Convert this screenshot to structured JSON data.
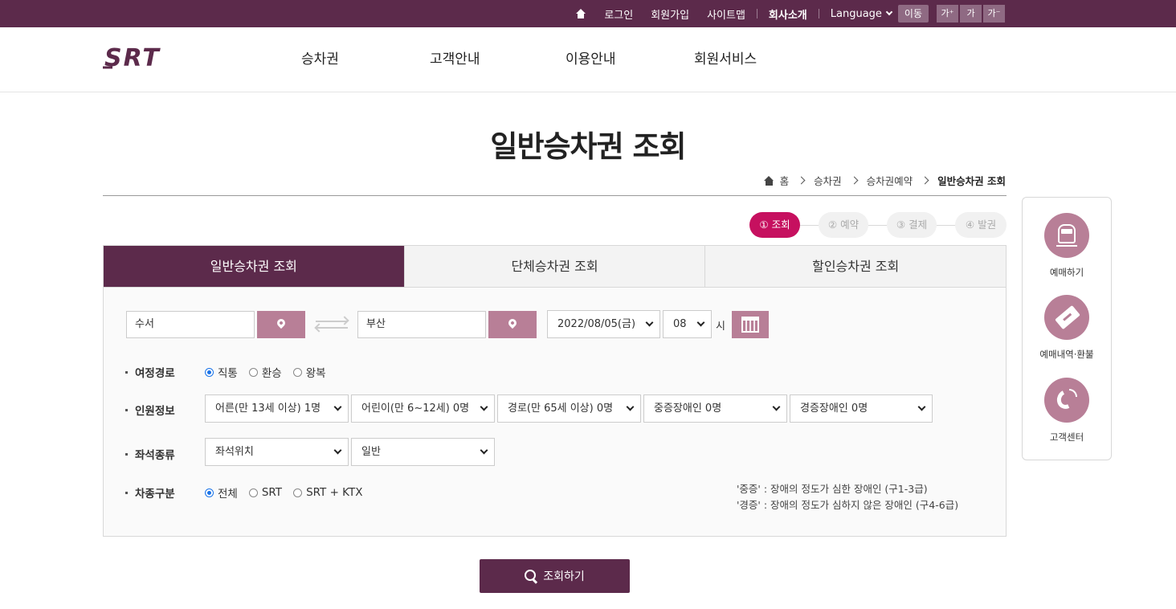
{
  "topbar": {
    "login": "로그인",
    "signup": "회원가입",
    "sitemap": "사이트맵",
    "company": "회사소개",
    "language": "Language",
    "go": "이동",
    "font_up": "가⁺",
    "font_normal": "가",
    "font_down": "가⁻"
  },
  "header": {
    "logo": "SRT",
    "nav": [
      "승차권",
      "고객안내",
      "이용안내",
      "회원서비스"
    ]
  },
  "page": {
    "title": "일반승차권 조회",
    "breadcrumb": [
      "홈",
      "승차권",
      "승차권예약",
      "일반승차권 조회"
    ]
  },
  "steps": [
    "① 조회",
    "② 예약",
    "③ 결제",
    "④ 발권"
  ],
  "tabs": [
    "일반승차권 조회",
    "단체승차권 조회",
    "할인승차권 조회"
  ],
  "form": {
    "departure": "수서",
    "arrival": "부산",
    "date": "2022/08/05(금)",
    "hour": "08",
    "hour_unit": "시",
    "route_label": "여정경로",
    "route_options": [
      "직통",
      "환승",
      "왕복"
    ],
    "passenger_label": "인원정보",
    "passengers": [
      "어른(만 13세 이상) 1명",
      "어린이(만 6~12세) 0명",
      "경로(만 65세 이상) 0명",
      "중증장애인 0명",
      "경증장애인 0명"
    ],
    "seat_label": "좌석종류",
    "seat_position": "좌석위치",
    "seat_class": "일반",
    "train_label": "차종구분",
    "train_options": [
      "전체",
      "SRT",
      "SRT + KTX"
    ],
    "note_severe": "'중증' : 장애의 정도가 심한 장애인 (구1-3급)",
    "note_mild": "'경증' : 장애의 정도가 심하지 않은 장애인 (구4-6급)"
  },
  "search_button": "조회하기",
  "quick_menu": [
    "예매하기",
    "예매내역·환불",
    "고객센터"
  ],
  "colors": {
    "brand": "#5c2a4b",
    "accent_pink": "#c6105f",
    "button_rose": "#b87f97"
  }
}
